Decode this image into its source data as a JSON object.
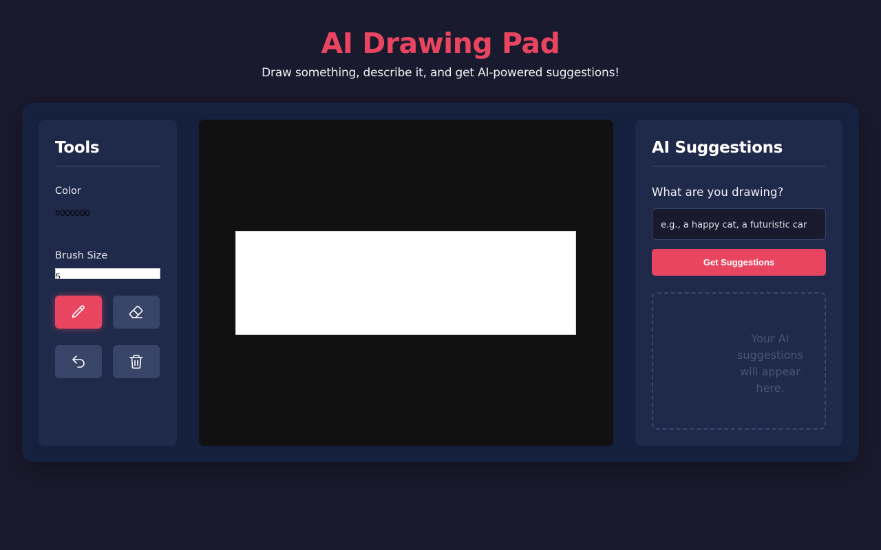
{
  "header": {
    "title": "AI Drawing Pad",
    "subtitle": "Draw something, describe it, and get AI-powered suggestions!"
  },
  "tools": {
    "title": "Tools",
    "color_label": "Color",
    "color_value": "#000000",
    "brush_label": "Brush Size",
    "brush_value": "5",
    "buttons": [
      {
        "name": "pencil-button",
        "icon": "pencil-icon",
        "active": true
      },
      {
        "name": "eraser-button",
        "icon": "eraser-icon",
        "active": false
      },
      {
        "name": "undo-button",
        "icon": "undo-icon",
        "active": false
      },
      {
        "name": "clear-button",
        "icon": "trash-icon",
        "active": false
      }
    ]
  },
  "ai": {
    "title": "AI Suggestions",
    "question": "What are you drawing?",
    "input_placeholder": "e.g., a happy cat, a futuristic car",
    "button_label": "Get Suggestions",
    "placeholder": "Your AI suggestions will appear here."
  },
  "colors": {
    "accent": "#e94560",
    "background": "#1a1a2e",
    "panel": "#1f2a4a",
    "canvas": "#111111"
  }
}
